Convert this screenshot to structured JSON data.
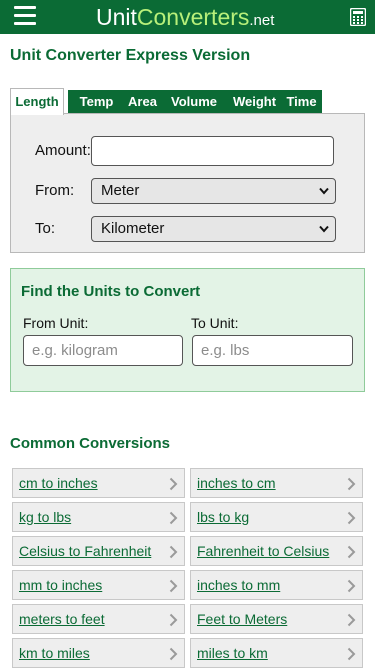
{
  "header": {
    "logo_part_a": "Unit",
    "logo_part_b": "Converters",
    "logo_part_c": ".net"
  },
  "page_title": "Unit Converter Express Version",
  "tabs": [
    {
      "label": "Length",
      "active": true
    },
    {
      "label": "Temp"
    },
    {
      "label": "Area"
    },
    {
      "label": "Volume"
    },
    {
      "label": "Weight"
    },
    {
      "label": "Time"
    }
  ],
  "converter": {
    "amount_label": "Amount:",
    "amount_value": "",
    "from_label": "From:",
    "from_value": "Meter",
    "to_label": "To:",
    "to_value": "Kilometer"
  },
  "find": {
    "title": "Find the Units to Convert",
    "from_label": "From Unit:",
    "from_placeholder": "e.g. kilogram",
    "to_label": "To Unit:",
    "to_placeholder": "e.g. lbs"
  },
  "common": {
    "title": "Common Conversions",
    "rows": [
      [
        "cm to inches",
        "inches to cm"
      ],
      [
        "kg to lbs",
        "lbs to kg"
      ],
      [
        "Celsius to Fahrenheit",
        "Fahrenheit to Celsius"
      ],
      [
        "mm to inches",
        "inches to mm"
      ],
      [
        "meters to feet",
        "Feet to Meters"
      ],
      [
        "km to miles",
        "miles to km"
      ]
    ]
  },
  "colors": {
    "brand_green": "#0b6b35",
    "logo_accent": "#b8f07a",
    "panel_bg": "#eeeeee",
    "find_bg": "#e3f3e6"
  },
  "icons": {
    "menu": "hamburger-icon",
    "calculator": "calculator-icon",
    "select": "chevron-down-icon",
    "link": "chevron-right-icon"
  }
}
